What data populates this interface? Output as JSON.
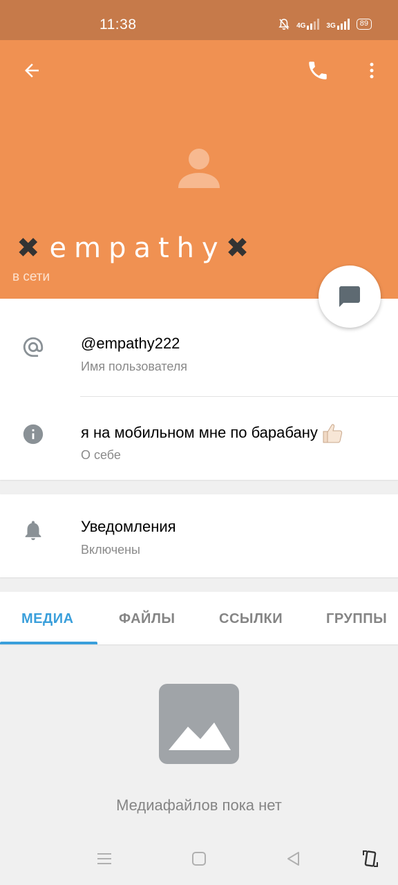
{
  "status_bar": {
    "time": "11:38",
    "network_1": "4G",
    "network_2": "3G",
    "battery": "89"
  },
  "header": {
    "name_prefix": "✖",
    "name": "empathy",
    "name_suffix": "✖",
    "status": "в сети",
    "background_color": "#f09152"
  },
  "info": {
    "username": "@empathy222",
    "username_label": "Имя пользователя",
    "bio": "я на мобильном мне по барабану",
    "bio_label": "О себе"
  },
  "notifications": {
    "title": "Уведомления",
    "state": "Включены"
  },
  "tabs": [
    {
      "label": "МЕДИА",
      "active": true
    },
    {
      "label": "ФАЙЛЫ",
      "active": false
    },
    {
      "label": "ССЫЛКИ",
      "active": false
    },
    {
      "label": "ГРУППЫ",
      "active": false
    }
  ],
  "empty_state": {
    "text": "Медиафайлов пока нет"
  },
  "colors": {
    "accent": "#3a9fdb",
    "header": "#f09152",
    "status_bar": "#c67a4a"
  },
  "icons": {
    "back": "arrow-left-icon",
    "call": "phone-icon",
    "more": "more-vertical-icon",
    "message": "message-icon",
    "username": "at-sign-icon",
    "bio": "info-icon",
    "notifications": "bell-icon",
    "empty": "image-icon"
  }
}
